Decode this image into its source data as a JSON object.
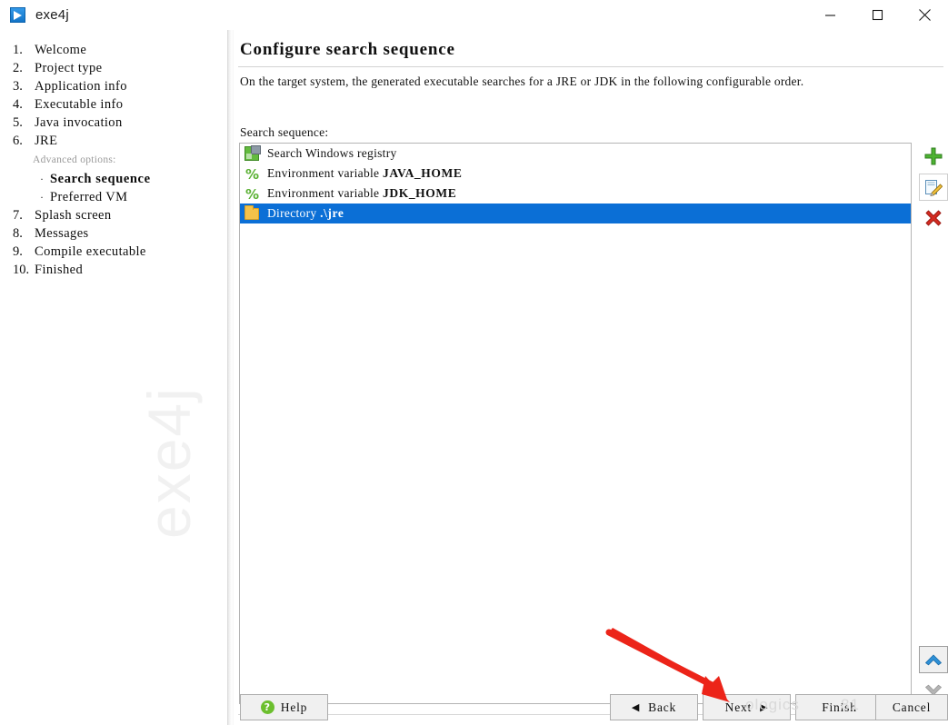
{
  "window": {
    "title": "exe4j",
    "app_icon": "exe4j-logo-icon",
    "minimize": "–",
    "maximize": "☐",
    "close": "✕"
  },
  "sidebar": {
    "watermark": "exe4j",
    "steps": [
      {
        "num": "1.",
        "label": "Welcome"
      },
      {
        "num": "2.",
        "label": "Project type"
      },
      {
        "num": "3.",
        "label": "Application info"
      },
      {
        "num": "4.",
        "label": "Executable info"
      },
      {
        "num": "5.",
        "label": "Java invocation"
      },
      {
        "num": "6.",
        "label": "JRE"
      }
    ],
    "advanced_label": "Advanced options:",
    "subitems": [
      {
        "bullet": "·",
        "label": "Search sequence",
        "active": true
      },
      {
        "bullet": "·",
        "label": "Preferred VM",
        "active": false
      }
    ],
    "steps_after": [
      {
        "num": "7.",
        "label": "Splash screen"
      },
      {
        "num": "8.",
        "label": "Messages"
      },
      {
        "num": "9.",
        "label": "Compile executable"
      },
      {
        "num": "10.",
        "label": "Finished"
      }
    ]
  },
  "main": {
    "page_title": "Configure search sequence",
    "description": "On the target system, the generated executable searches for a JRE or JDK in the following configurable order.",
    "list_label": "Search sequence:",
    "list_items": [
      {
        "icon": "windows-registry-icon",
        "text": "Search Windows registry",
        "bold": "",
        "selected": false
      },
      {
        "icon": "environment-variable-icon",
        "text": "Environment variable ",
        "bold": "JAVA_HOME",
        "selected": false
      },
      {
        "icon": "environment-variable-icon",
        "text": "Environment variable ",
        "bold": "JDK_HOME",
        "selected": false
      },
      {
        "icon": "folder-icon",
        "text": "Directory ",
        "bold": ".\\jre",
        "selected": true
      }
    ],
    "selection_color": "#0b6fd6"
  },
  "tools": {
    "add": {
      "name": "add-icon",
      "title": "Add"
    },
    "edit": {
      "name": "edit-icon",
      "title": "Edit"
    },
    "delete": {
      "name": "delete-icon",
      "title": "Remove"
    },
    "move_up": {
      "name": "move-up-icon",
      "title": "Move up",
      "enabled": true
    },
    "move_down": {
      "name": "move-down-icon",
      "title": "Move down",
      "enabled": false
    }
  },
  "footer": {
    "help": "Help",
    "back": "Back",
    "next": "Next",
    "finish": "Finish",
    "cancel": "Cancel",
    "back_arrow": "◀",
    "next_arrow": "▶",
    "help_glyph": "?"
  },
  "annotations": {
    "red_arrow": "red-pointer-arrow",
    "arrow_color": "#ec2419"
  },
  "watermarks": {
    "w1": "ologics",
    "w2": "81"
  }
}
